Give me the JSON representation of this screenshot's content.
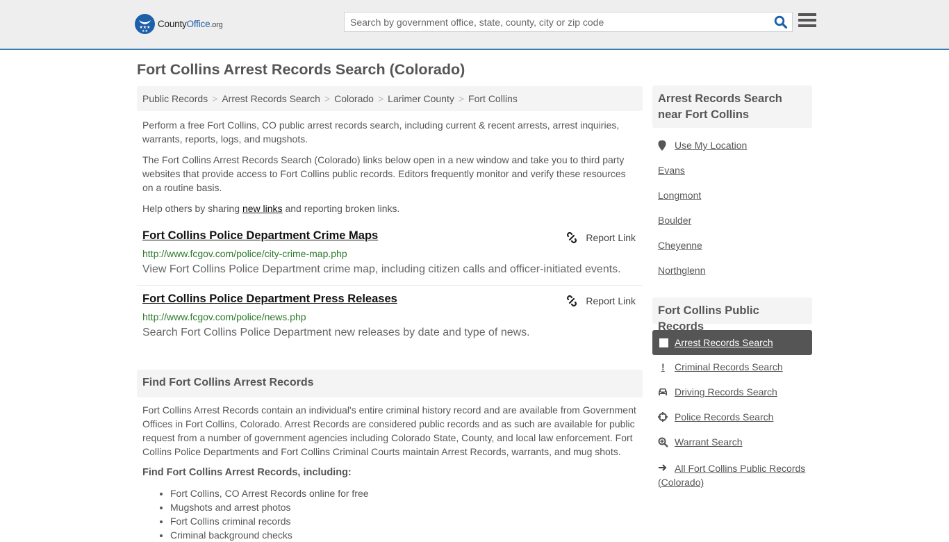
{
  "header": {
    "logo": {
      "county": "County",
      "office": "Office",
      "org": ".org"
    },
    "search_placeholder": "Search by government office, state, county, city or zip code",
    "search_icon": "search-icon",
    "menu_icon": "hamburger-menu-icon"
  },
  "page_title": "Fort Collins Arrest Records Search (Colorado)",
  "breadcrumb": [
    "Public Records",
    "Arrest Records Search",
    "Colorado",
    "Larimer County",
    "Fort Collins"
  ],
  "intro": {
    "p1": "Perform a free Fort Collins, CO public arrest records search, including current & recent arrests, arrest inquiries, warrants, reports, logs, and mugshots.",
    "p2": "The Fort Collins Arrest Records Search (Colorado) links below open in a new window and take you to third party websites that provide access to Fort Collins public records. Editors frequently monitor and verify these resources on a routine basis.",
    "p3_before": "Help others by sharing ",
    "p3_link": "new links",
    "p3_after": " and reporting broken links."
  },
  "results": [
    {
      "title": "Fort Collins Police Department Crime Maps",
      "url": "http://www.fcgov.com/police/city-crime-map.php",
      "description": "View Fort Collins Police Department crime map, including citizen calls and officer-initiated events.",
      "report_label": "Report Link"
    },
    {
      "title": "Fort Collins Police Department Press Releases",
      "url": "http://www.fcgov.com/police/news.php",
      "description": "Search Fort Collins Police Department new releases by date and type of news.",
      "report_label": "Report Link"
    }
  ],
  "find_section": {
    "heading": "Find Fort Collins Arrest Records",
    "body": "Fort Collins Arrest Records contain an individual's entire criminal history record and are available from Government Offices in Fort Collins, Colorado. Arrest Records are considered public records and as such are available for public request from a number of government agencies including Colorado State, County, and local law enforcement. Fort Collins Police Departments and Fort Collins Criminal Courts maintain Arrest Records, warrants, and mug shots.",
    "subheading": "Find Fort Collins Arrest Records, including:",
    "bullets": [
      "Fort Collins, CO Arrest Records online for free",
      "Mugshots and arrest photos",
      "Fort Collins criminal records",
      "Criminal background checks"
    ]
  },
  "sidebar": {
    "nearby_heading": "Arrest Records Search near Fort Collins",
    "use_location": "Use My Location",
    "nearby": [
      "Evans",
      "Longmont",
      "Boulder",
      "Cheyenne",
      "Northglenn"
    ],
    "public_records_heading": "Fort Collins Public Records",
    "records_links": [
      {
        "label": "Arrest Records Search",
        "icon": "square-icon",
        "active": true
      },
      {
        "label": "Criminal Records Search",
        "icon": "exclamation-icon",
        "active": false
      },
      {
        "label": "Driving Records Search",
        "icon": "car-icon",
        "active": false
      },
      {
        "label": "Police Records Search",
        "icon": "crosshairs-icon",
        "active": false
      },
      {
        "label": "Warrant Search",
        "icon": "search-plus-icon",
        "active": false
      },
      {
        "label": "All Fort Collins Public Records (Colorado)",
        "icon": "arrow-right-icon",
        "active": false
      }
    ]
  }
}
